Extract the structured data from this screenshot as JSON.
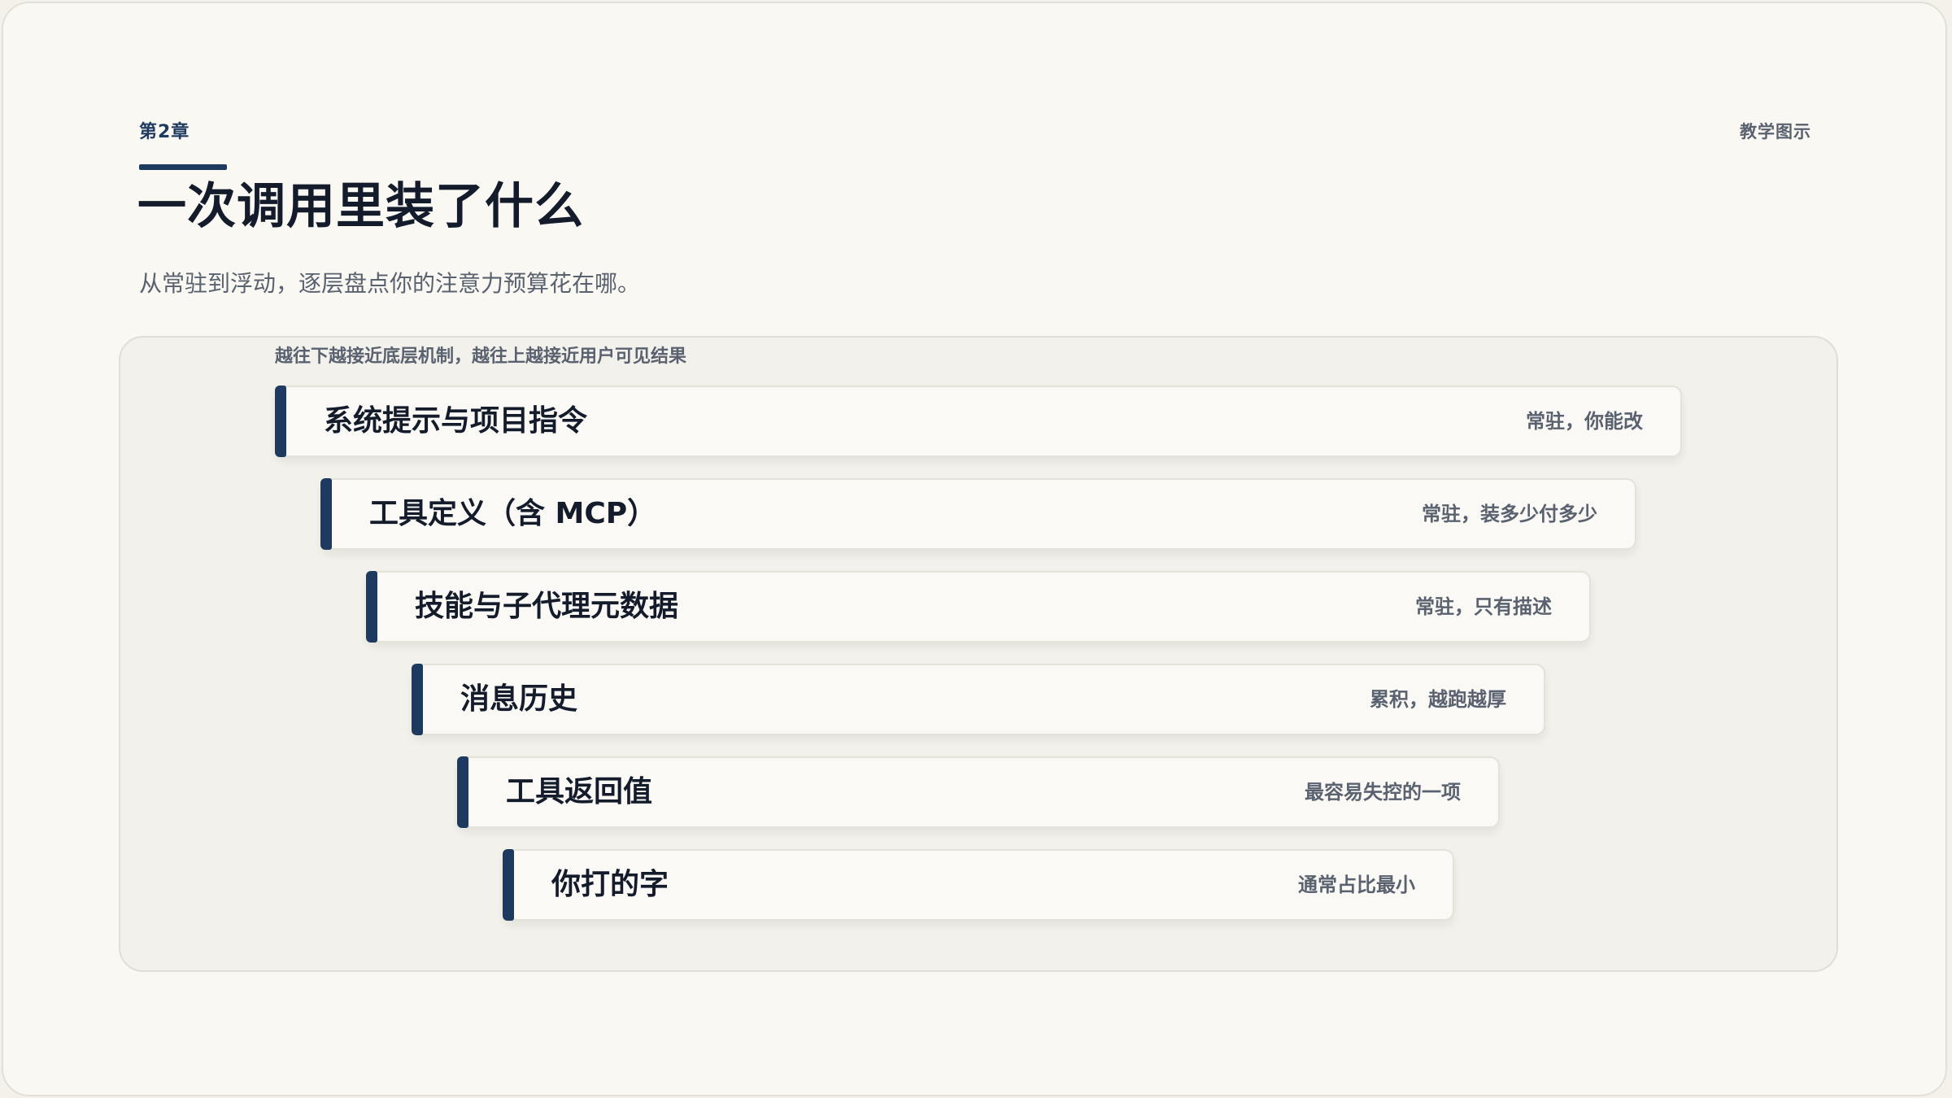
{
  "header": {
    "chapter": "第2章",
    "category": "教学图示",
    "title": "一次调用里装了什么",
    "subtitle": "从常驻到浮动，逐层盘点你的注意力预算花在哪。"
  },
  "diagram": {
    "caption": "越往下越接近底层机制，越往上越接近用户可见结果",
    "layers": [
      {
        "name": "系统提示与项目指令",
        "note": "常驻，你能改"
      },
      {
        "name": "工具定义（含 MCP）",
        "note": "常驻，装多少付多少"
      },
      {
        "name": "技能与子代理元数据",
        "note": "常驻，只有描述"
      },
      {
        "name": "消息历史",
        "note": "累积，越跑越厚"
      },
      {
        "name": "工具返回值",
        "note": "最容易失控的一项"
      },
      {
        "name": "你打的字",
        "note": "通常占比最小"
      }
    ]
  },
  "colors": {
    "accent": "#1f3a5f",
    "background": "#f9f8f3",
    "panel": "#f2f1eb",
    "text_primary": "#141c2b",
    "text_secondary": "#5a6270"
  }
}
